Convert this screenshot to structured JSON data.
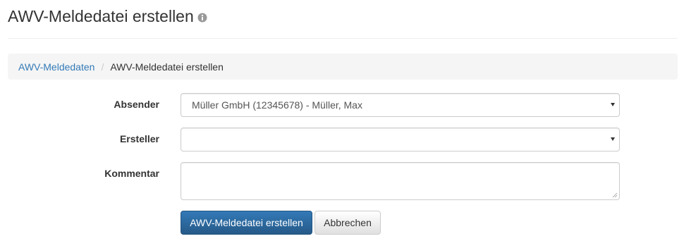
{
  "header": {
    "title": "AWV-Meldedatei erstellen",
    "info_icon": "info-circle-icon"
  },
  "breadcrumb": {
    "items": [
      {
        "label": "AWV-Meldedaten"
      },
      {
        "label": "AWV-Meldedatei erstellen"
      }
    ],
    "separator": "/"
  },
  "form": {
    "absender": {
      "label": "Absender",
      "value": "Müller GmbH (12345678) - Müller, Max"
    },
    "ersteller": {
      "label": "Ersteller",
      "value": ""
    },
    "kommentar": {
      "label": "Kommentar",
      "value": ""
    }
  },
  "actions": {
    "submit_label": "AWV-Meldedatei erstellen",
    "cancel_label": "Abbrechen"
  },
  "colors": {
    "link": "#337ab7",
    "primary": "#337ab7",
    "breadcrumb_bg": "#f5f5f5"
  }
}
